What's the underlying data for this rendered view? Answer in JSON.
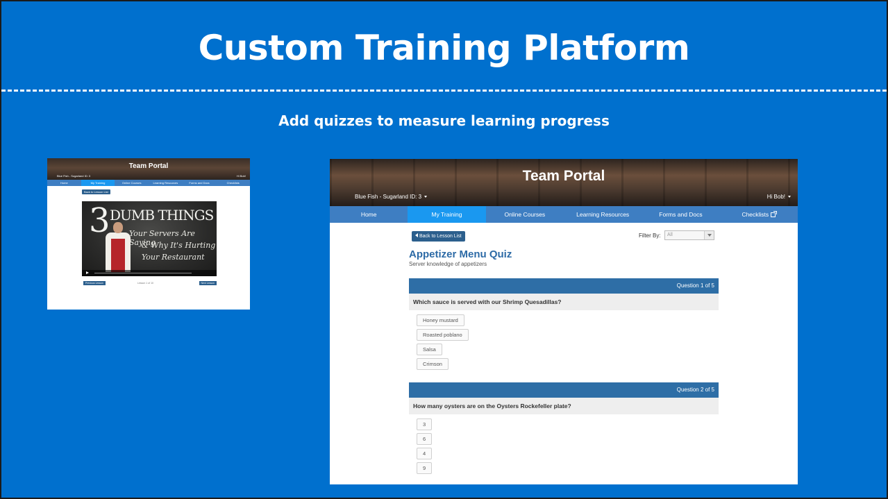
{
  "slide": {
    "title": "Custom Training Platform",
    "subtitle": "Add quizzes to measure learning progress"
  },
  "small_screenshot": {
    "portal_title": "Team Portal",
    "location": "Blue Fish - Sugarland ID: 3",
    "greeting": "Hi Bob!",
    "nav": [
      "Home",
      "My Training",
      "Online Courses",
      "Learning Resources",
      "Forms and Docs",
      "Checklists"
    ],
    "back_label": "Back to Lesson List",
    "video": {
      "big_number": "3",
      "headline": "DUMB THINGS",
      "lines": [
        "Your Servers Are Saying",
        "& Why It's Hurting",
        "Your Restaurant"
      ]
    },
    "prev_label": "Previous Lesson",
    "lesson_label": "Lesson 1 of 10",
    "next_label": "Next Lesson"
  },
  "portal": {
    "title": "Team Portal",
    "location": "Blue Fish - Sugarland ID: 3",
    "greeting": "Hi Bob!",
    "nav": {
      "home": "Home",
      "my_training": "My Training",
      "online_courses": "Online Courses",
      "learning_resources": "Learning Resources",
      "forms_docs": "Forms and Docs",
      "checklists": "Checklists"
    },
    "back_label": "Back to Lesson List",
    "filter_label": "Filter By:",
    "filter_value": "All",
    "quiz": {
      "title": "Appetizer Menu Quiz",
      "subtitle": "Server knowledge of appetizers",
      "questions": [
        {
          "counter": "Question 1 of 5",
          "text": "Which sauce is served with our Shrimp Quesadillas?",
          "answers": [
            "Honey mustard",
            "Roasted poblano",
            "Salsa",
            "Crimson"
          ]
        },
        {
          "counter": "Question 2 of 5",
          "text": "How many oysters are on the Oysters Rockefeller plate?",
          "answers": [
            "3",
            "6",
            "4",
            "9"
          ]
        }
      ]
    }
  },
  "colors": {
    "slide_bg": "#0070ce",
    "nav_bg": "#3e7ec2",
    "nav_active": "#1a98f0",
    "question_header": "#2e6ea6",
    "quiz_title": "#2c6aa6"
  }
}
